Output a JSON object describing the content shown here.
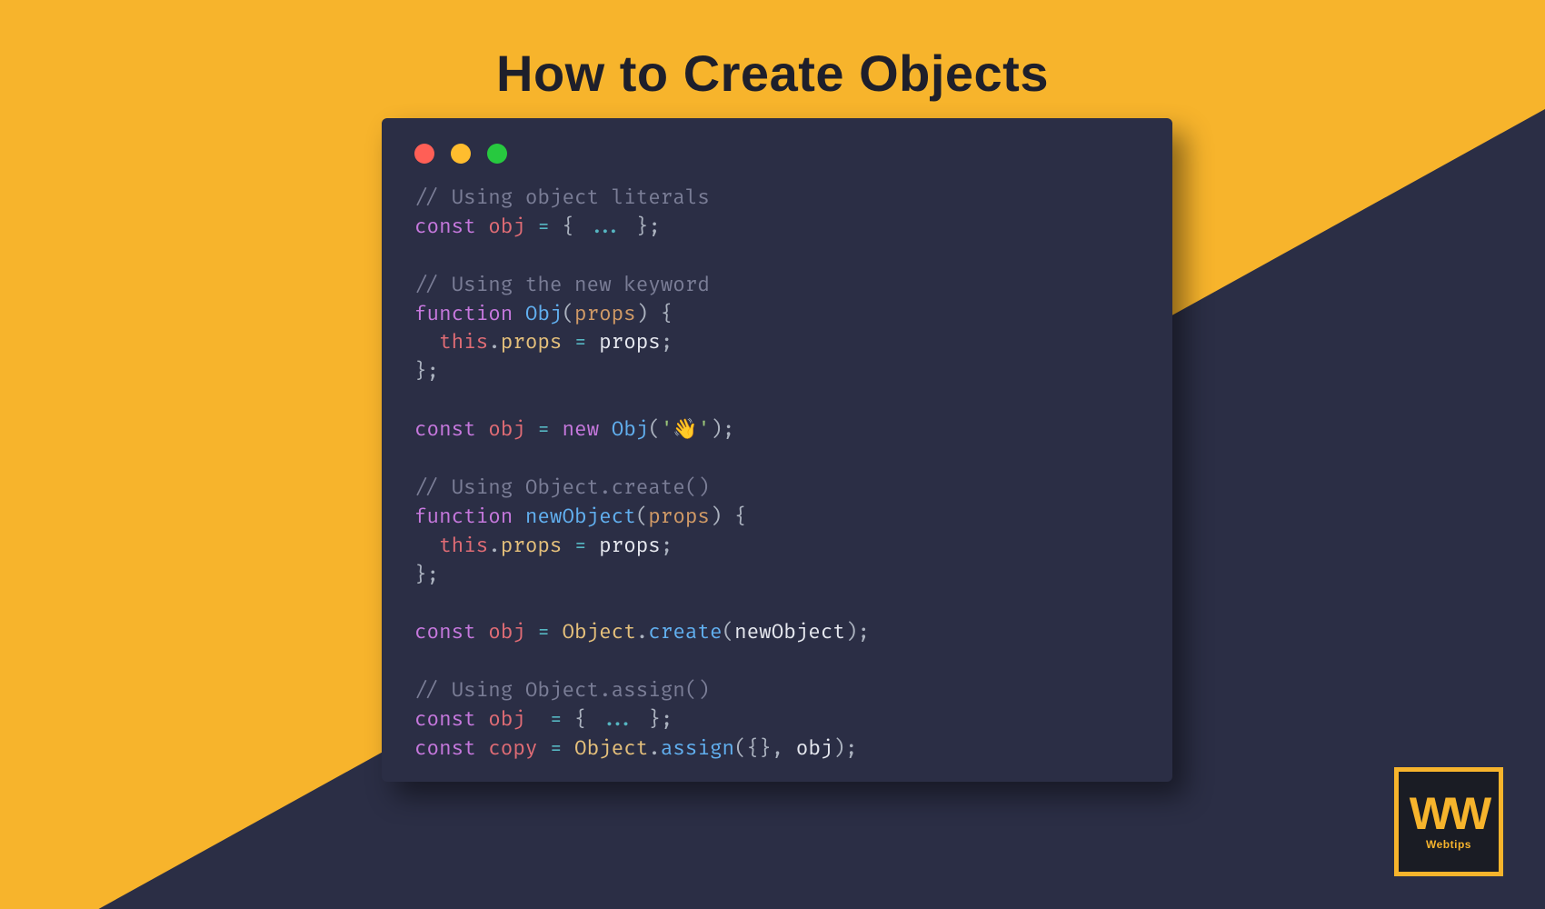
{
  "title": "How to Create Objects",
  "traffic_colors": {
    "red": "#ff5f56",
    "orange": "#ffbd2e",
    "green": "#27c93f"
  },
  "brand": {
    "mark": "WW",
    "label": "Webtips"
  },
  "code": {
    "tokens": [
      [
        [
          "tk-comment",
          "// Using object literals"
        ]
      ],
      [
        [
          "tk-keyword",
          "const"
        ],
        [
          "tk-white",
          " "
        ],
        [
          "tk-var",
          "obj"
        ],
        [
          "tk-white",
          " "
        ],
        [
          "tk-op",
          "="
        ],
        [
          "tk-white",
          " "
        ],
        [
          "tk-punc",
          "{"
        ],
        [
          "tk-white",
          " "
        ],
        [
          "tk-op",
          "..."
        ],
        [
          "tk-white",
          " "
        ],
        [
          "tk-punc",
          "}"
        ],
        [
          "tk-punc",
          ";"
        ]
      ],
      [],
      [
        [
          "tk-comment",
          "// Using the new keyword"
        ]
      ],
      [
        [
          "tk-keyword",
          "function"
        ],
        [
          "tk-white",
          " "
        ],
        [
          "tk-func",
          "Obj"
        ],
        [
          "tk-punc",
          "("
        ],
        [
          "tk-param",
          "props"
        ],
        [
          "tk-punc",
          ")"
        ],
        [
          "tk-white",
          " "
        ],
        [
          "tk-punc",
          "{"
        ]
      ],
      [
        [
          "tk-white",
          "  "
        ],
        [
          "tk-this",
          "this"
        ],
        [
          "tk-punc",
          "."
        ],
        [
          "tk-prop",
          "props"
        ],
        [
          "tk-white",
          " "
        ],
        [
          "tk-op",
          "="
        ],
        [
          "tk-white",
          " "
        ],
        [
          "tk-white",
          "props"
        ],
        [
          "tk-punc",
          ";"
        ]
      ],
      [
        [
          "tk-punc",
          "}"
        ],
        [
          "tk-punc",
          ";"
        ]
      ],
      [],
      [
        [
          "tk-keyword",
          "const"
        ],
        [
          "tk-white",
          " "
        ],
        [
          "tk-var",
          "obj"
        ],
        [
          "tk-white",
          " "
        ],
        [
          "tk-op",
          "="
        ],
        [
          "tk-white",
          " "
        ],
        [
          "tk-keyword",
          "new"
        ],
        [
          "tk-white",
          " "
        ],
        [
          "tk-func",
          "Obj"
        ],
        [
          "tk-punc",
          "("
        ],
        [
          "tk-str",
          "'👋'"
        ],
        [
          "tk-punc",
          ")"
        ],
        [
          "tk-punc",
          ";"
        ]
      ],
      [],
      [
        [
          "tk-comment",
          "// Using Object.create()"
        ]
      ],
      [
        [
          "tk-keyword",
          "function"
        ],
        [
          "tk-white",
          " "
        ],
        [
          "tk-func",
          "newObject"
        ],
        [
          "tk-punc",
          "("
        ],
        [
          "tk-param",
          "props"
        ],
        [
          "tk-punc",
          ")"
        ],
        [
          "tk-white",
          " "
        ],
        [
          "tk-punc",
          "{"
        ]
      ],
      [
        [
          "tk-white",
          "  "
        ],
        [
          "tk-this",
          "this"
        ],
        [
          "tk-punc",
          "."
        ],
        [
          "tk-prop",
          "props"
        ],
        [
          "tk-white",
          " "
        ],
        [
          "tk-op",
          "="
        ],
        [
          "tk-white",
          " "
        ],
        [
          "tk-white",
          "props"
        ],
        [
          "tk-punc",
          ";"
        ]
      ],
      [
        [
          "tk-punc",
          "}"
        ],
        [
          "tk-punc",
          ";"
        ]
      ],
      [],
      [
        [
          "tk-keyword",
          "const"
        ],
        [
          "tk-white",
          " "
        ],
        [
          "tk-var",
          "obj"
        ],
        [
          "tk-white",
          " "
        ],
        [
          "tk-op",
          "="
        ],
        [
          "tk-white",
          " "
        ],
        [
          "tk-prop",
          "Object"
        ],
        [
          "tk-punc",
          "."
        ],
        [
          "tk-func",
          "create"
        ],
        [
          "tk-punc",
          "("
        ],
        [
          "tk-white",
          "newObject"
        ],
        [
          "tk-punc",
          ")"
        ],
        [
          "tk-punc",
          ";"
        ]
      ],
      [],
      [
        [
          "tk-comment",
          "// Using Object.assign()"
        ]
      ],
      [
        [
          "tk-keyword",
          "const"
        ],
        [
          "tk-white",
          " "
        ],
        [
          "tk-var",
          "obj"
        ],
        [
          "tk-white",
          "  "
        ],
        [
          "tk-op",
          "="
        ],
        [
          "tk-white",
          " "
        ],
        [
          "tk-punc",
          "{"
        ],
        [
          "tk-white",
          " "
        ],
        [
          "tk-op",
          "..."
        ],
        [
          "tk-white",
          " "
        ],
        [
          "tk-punc",
          "}"
        ],
        [
          "tk-punc",
          ";"
        ]
      ],
      [
        [
          "tk-keyword",
          "const"
        ],
        [
          "tk-white",
          " "
        ],
        [
          "tk-var",
          "copy"
        ],
        [
          "tk-white",
          " "
        ],
        [
          "tk-op",
          "="
        ],
        [
          "tk-white",
          " "
        ],
        [
          "tk-prop",
          "Object"
        ],
        [
          "tk-punc",
          "."
        ],
        [
          "tk-func",
          "assign"
        ],
        [
          "tk-punc",
          "("
        ],
        [
          "tk-punc",
          "{}"
        ],
        [
          "tk-punc",
          ","
        ],
        [
          "tk-white",
          " "
        ],
        [
          "tk-white",
          "obj"
        ],
        [
          "tk-punc",
          ")"
        ],
        [
          "tk-punc",
          ";"
        ]
      ]
    ]
  }
}
